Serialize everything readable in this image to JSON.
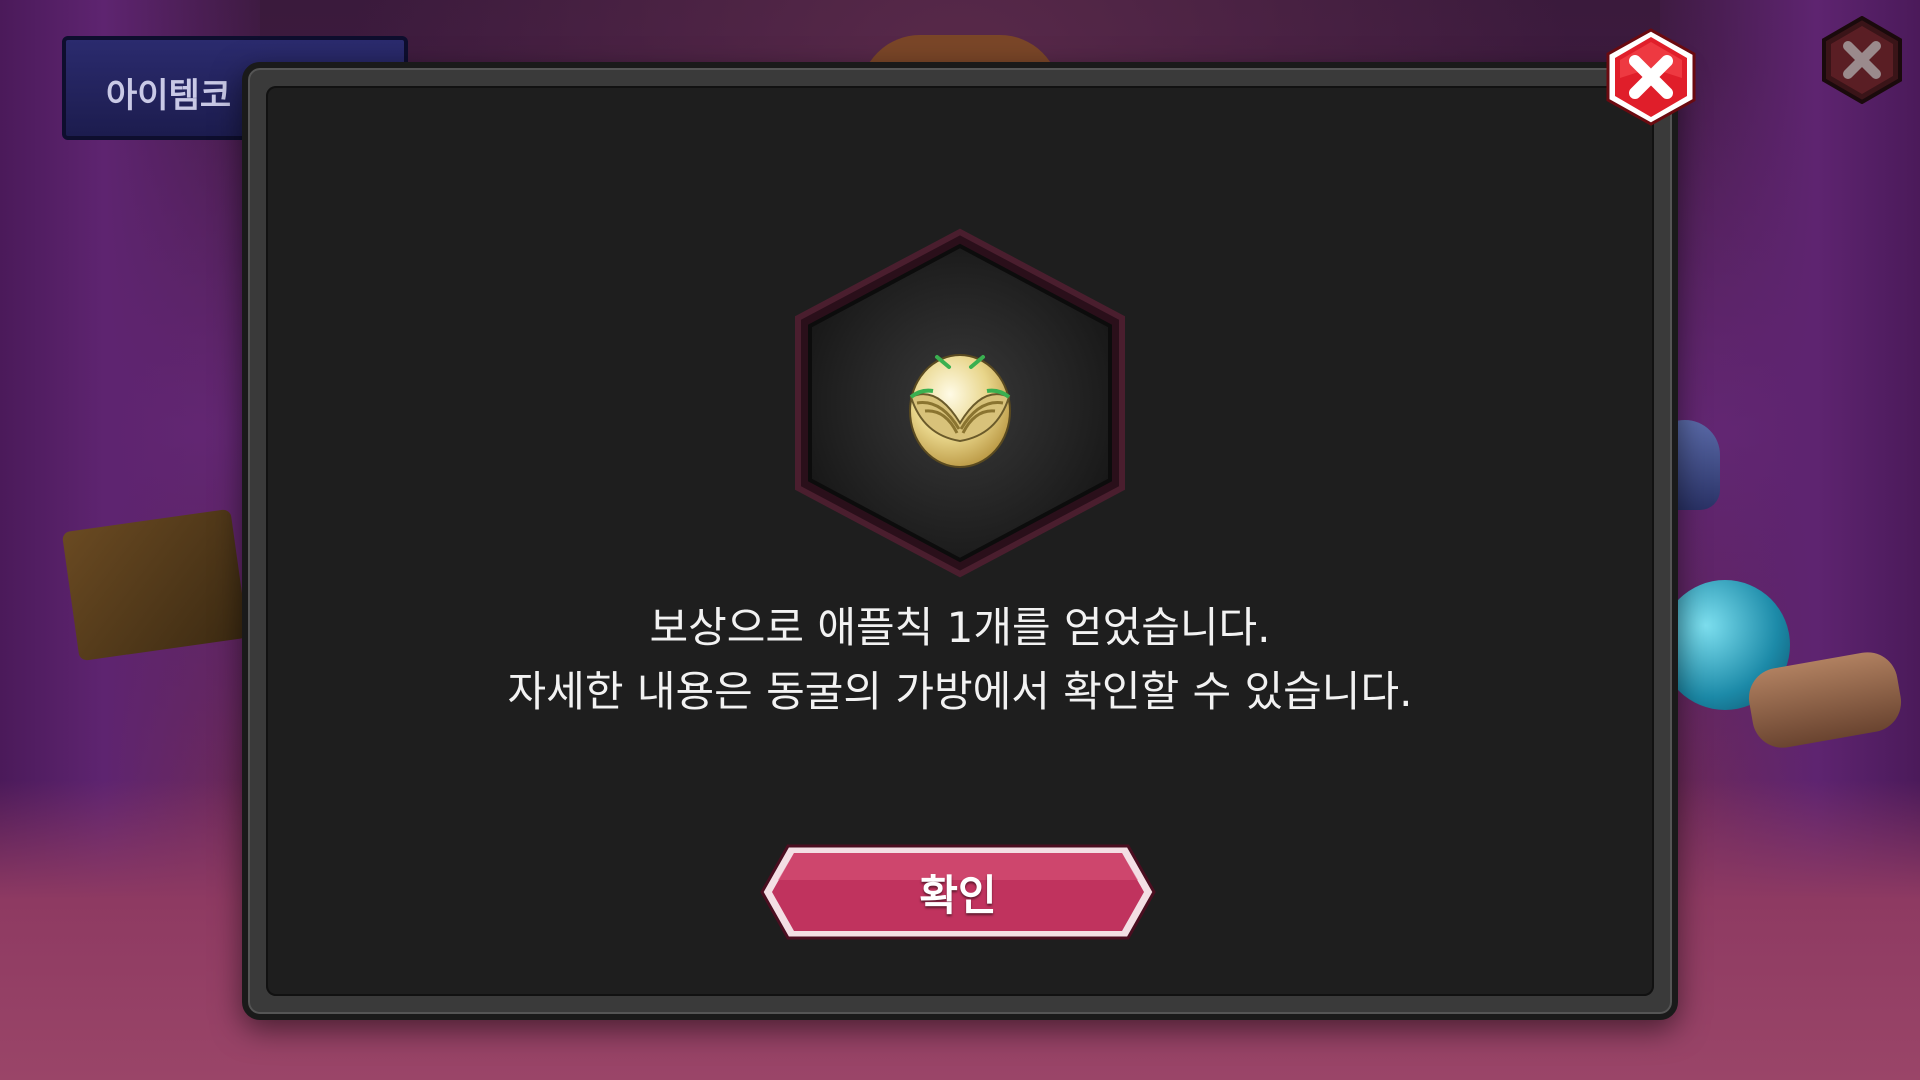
{
  "background": {
    "item_code_tab_label": "아이템코"
  },
  "dialog": {
    "message_line1": "보상으로 애플칙 1개를 얻었습니다.",
    "message_line2": "자세한 내용은 동굴의 가방에서 확인할 수 있습니다.",
    "confirm_label": "확인",
    "reward_icon": "winged-egg-icon",
    "close_icon": "close-icon"
  },
  "colors": {
    "confirm_button": "#c0335e",
    "close_button": "#e01e2a",
    "hex_border": "#4a1e2e",
    "dialog_bg": "#1e1e1e"
  }
}
